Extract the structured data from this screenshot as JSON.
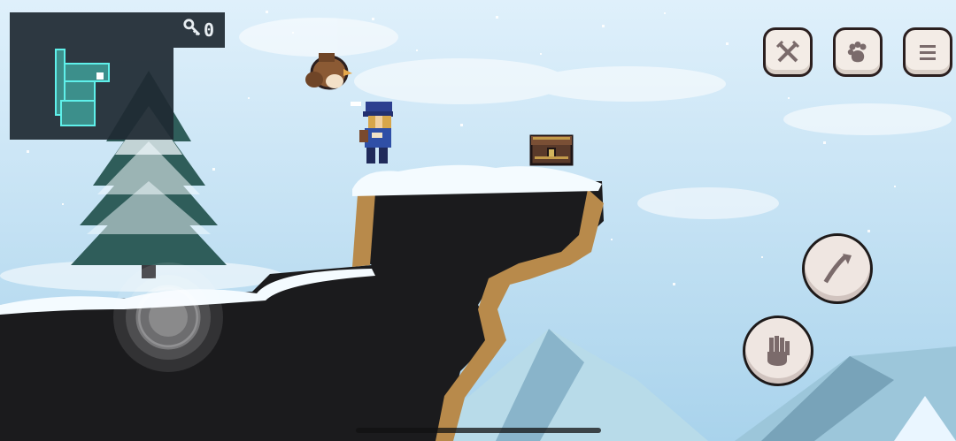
{
  "hud": {
    "keys_count": "0",
    "icons": {
      "key": "key-icon",
      "weapons": "crossed-swords-icon",
      "pets": "paw-icon",
      "menu": "menu-icon",
      "jump": "jump-arrow-icon",
      "grab": "hand-icon"
    }
  },
  "colors": {
    "sky_top": "#dff0fb",
    "sky_bottom": "#a9d3ec",
    "snow": "#f4fbff",
    "rock_dark": "#1b1b1d",
    "rock_edge": "#b88a4b",
    "mountain": "#b8dbe9",
    "mountain_shadow": "#7aa7bf",
    "button_fill": "#f3ece6",
    "button_outline": "#2b1f1f",
    "minimap_room": "#3c8f8b",
    "minimap_outline": "#5ff0ea"
  }
}
